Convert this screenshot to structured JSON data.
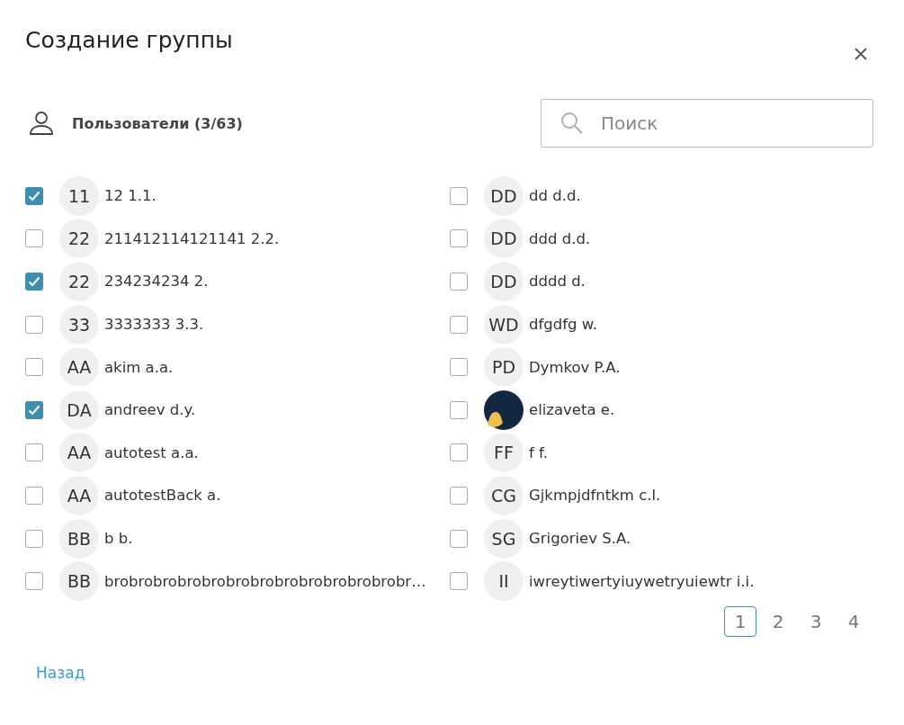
{
  "dialog": {
    "title": "Создание группы"
  },
  "users_header": {
    "label": "Пользователи (3/63)"
  },
  "search": {
    "placeholder": "Поиск"
  },
  "columns": [
    {
      "users": [
        {
          "initials": "11",
          "name": "12 1.1.",
          "checked": true,
          "kind": "initials"
        },
        {
          "initials": "22",
          "name": "211412114121141 2.2.",
          "checked": false,
          "kind": "initials"
        },
        {
          "initials": "22",
          "name": "234234234 2.",
          "checked": true,
          "kind": "initials"
        },
        {
          "initials": "33",
          "name": "3333333 3.3.",
          "checked": false,
          "kind": "initials"
        },
        {
          "initials": "AA",
          "name": "akim a.a.",
          "checked": false,
          "kind": "initials"
        },
        {
          "initials": "DA",
          "name": "andreev d.y.",
          "checked": true,
          "kind": "initials"
        },
        {
          "initials": "AA",
          "name": "autotest a.a.",
          "checked": false,
          "kind": "initials"
        },
        {
          "initials": "AA",
          "name": "autotestBack a.",
          "checked": false,
          "kind": "initials"
        },
        {
          "initials": "BB",
          "name": "b b.",
          "checked": false,
          "kind": "initials"
        },
        {
          "initials": "BB",
          "name": "brobrobrobrobrobrobrobrobrobrobrobrobr…",
          "checked": false,
          "kind": "initials"
        }
      ]
    },
    {
      "users": [
        {
          "initials": "DD",
          "name": "dd d.d.",
          "checked": false,
          "kind": "initials"
        },
        {
          "initials": "DD",
          "name": "ddd d.d.",
          "checked": false,
          "kind": "initials"
        },
        {
          "initials": "DD",
          "name": "dddd d.",
          "checked": false,
          "kind": "initials"
        },
        {
          "initials": "WD",
          "name": "dfgdfg w.",
          "checked": false,
          "kind": "initials"
        },
        {
          "initials": "PD",
          "name": "Dymkov P.A.",
          "checked": false,
          "kind": "initials"
        },
        {
          "name": "elizaveta e.",
          "checked": false,
          "kind": "photo"
        },
        {
          "initials": "FF",
          "name": "f f.",
          "checked": false,
          "kind": "initials"
        },
        {
          "initials": "CG",
          "name": "Gjkmpjdfntkm c.l.",
          "checked": false,
          "kind": "initials"
        },
        {
          "initials": "SG",
          "name": "Grigoriev S.A.",
          "checked": false,
          "kind": "initials"
        },
        {
          "initials": "II",
          "name": "iwreytiwertyiuywetryuiewtr i.i.",
          "checked": false,
          "kind": "initials"
        }
      ]
    }
  ],
  "pagination": [
    {
      "label": "1",
      "selected": true
    },
    {
      "label": "2",
      "selected": false
    },
    {
      "label": "3",
      "selected": false
    },
    {
      "label": "4",
      "selected": false
    }
  ],
  "back_link": {
    "label": "Назад"
  }
}
